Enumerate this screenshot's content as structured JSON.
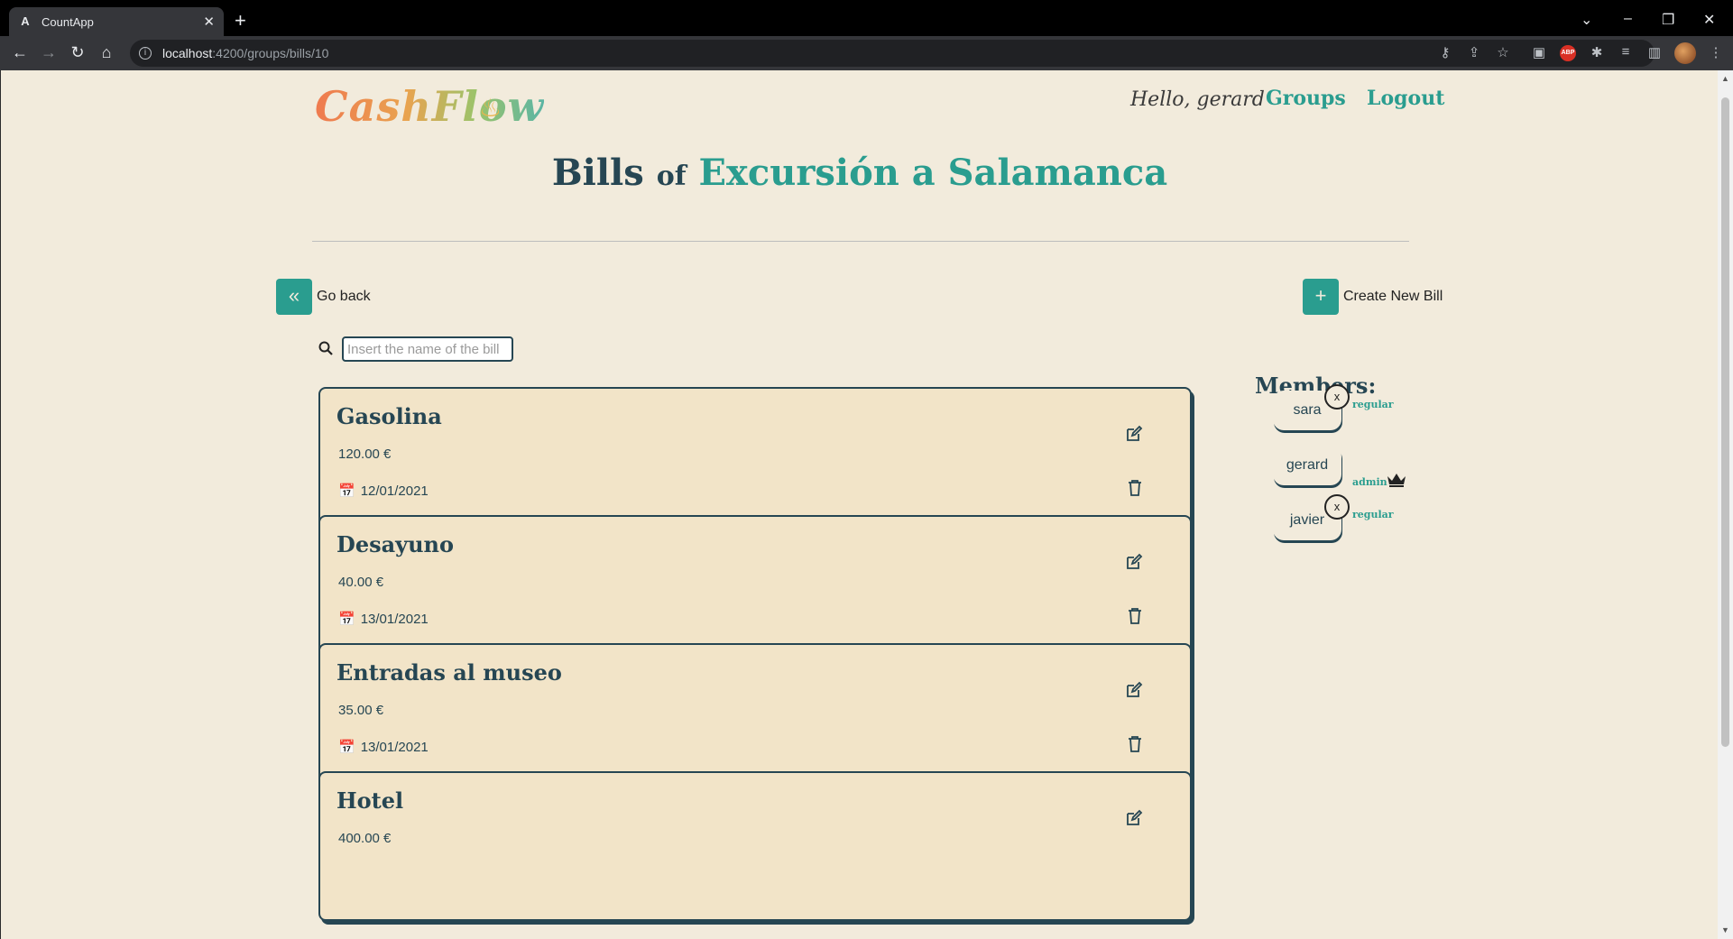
{
  "browser": {
    "tab_title": "CountApp",
    "tab_favicon": "A",
    "url_host": "localhost",
    "url_path": ":4200/groups/bills/10"
  },
  "header": {
    "logo": "CashFlow",
    "greeting": "Hello, gerard",
    "groups_link": "Groups",
    "logout_link": "Logout"
  },
  "heading": {
    "word1": "Bills",
    "word2": "of",
    "group_name": "Excursión a Salamanca"
  },
  "actions": {
    "go_back": "Go back",
    "create_bill": "Create New Bill"
  },
  "search": {
    "placeholder": "Insert the name of the bill",
    "value": ""
  },
  "bills": [
    {
      "name": "Gasolina",
      "amount": "120.00 €",
      "date": "12/01/2021"
    },
    {
      "name": "Desayuno",
      "amount": "40.00 €",
      "date": "13/01/2021"
    },
    {
      "name": "Entradas al museo",
      "amount": "35.00 €",
      "date": "13/01/2021"
    },
    {
      "name": "Hotel",
      "amount": "400.00 €",
      "date": ""
    }
  ],
  "members": {
    "title": "Members:",
    "list": [
      {
        "name": "sara",
        "role": "regular",
        "removable": true
      },
      {
        "name": "gerard",
        "role": "admin",
        "removable": false
      },
      {
        "name": "javier",
        "role": "regular",
        "removable": true
      }
    ],
    "remove_label": "x"
  },
  "colors": {
    "accent": "#2a9d8f",
    "dark": "#264653",
    "background": "#f2ebdc",
    "card": "#f2e4c8"
  }
}
